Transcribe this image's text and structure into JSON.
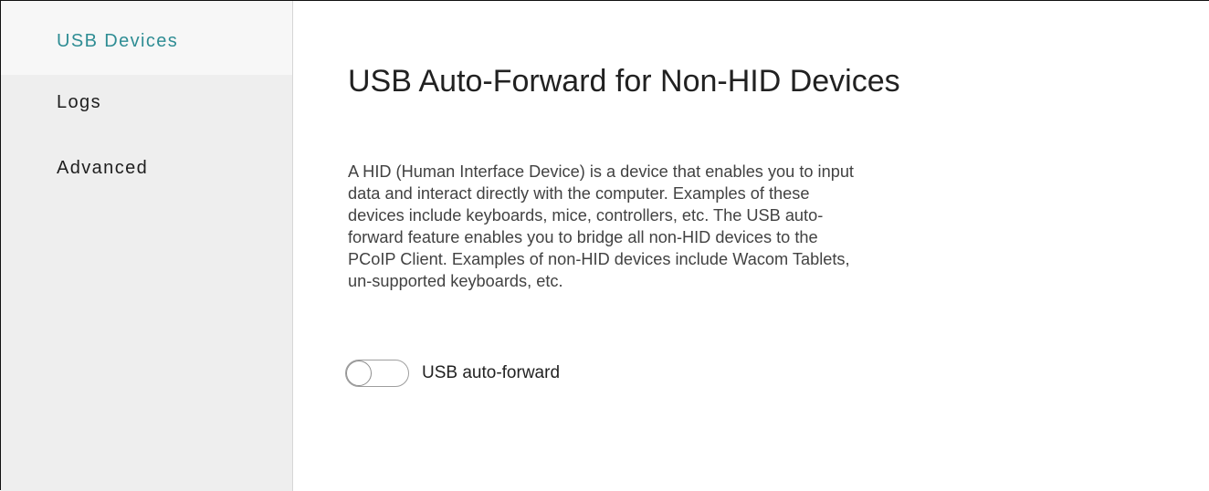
{
  "sidebar": {
    "items": [
      {
        "label": "USB Devices",
        "active": true
      },
      {
        "label": "Logs",
        "active": false
      },
      {
        "label": "Advanced",
        "active": false
      }
    ]
  },
  "main": {
    "title": "USB Auto-Forward for Non-HID Devices",
    "description": "A HID (Human Interface Device) is a device that enables you to input data and interact directly with the computer. Examples of these devices include keyboards, mice, controllers, etc. The USB auto-forward feature enables you to bridge all non-HID devices to the PCoIP Client. Examples of non-HID devices include Wacom Tablets, un-supported keyboards, etc.",
    "toggle": {
      "label": "USB auto-forward",
      "checked": false
    }
  },
  "colors": {
    "accent": "#2f8d94",
    "sidebar_bg": "#eeeeee",
    "active_item_bg": "#f7f7f7"
  }
}
